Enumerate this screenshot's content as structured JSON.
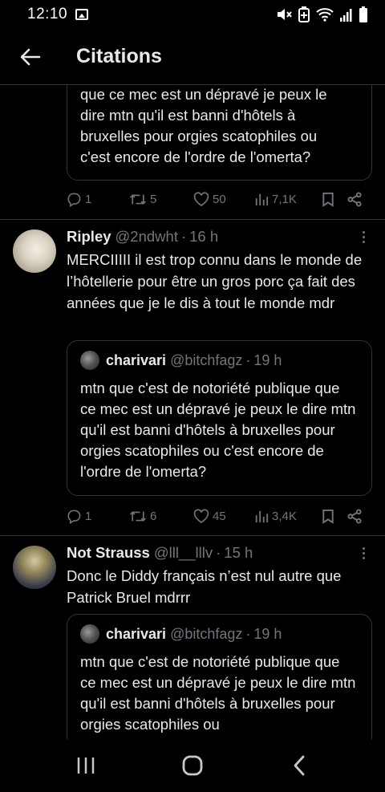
{
  "status_bar": {
    "time": "12:10"
  },
  "header": {
    "title": "Citations"
  },
  "first_tweet": {
    "quote_text_lines": [
      "que ce mec est un dépravé je peux le",
      "dire mtn qu'il est banni d'hôtels à",
      "bruxelles pour orgies scatophiles ou",
      "c'est encore de l'ordre de l'omerta?"
    ],
    "actions": {
      "replies": "1",
      "retweets": "5",
      "likes": "50",
      "views": "7,1K"
    }
  },
  "tweets": [
    {
      "name": "Ripley",
      "handle": "@2ndwht",
      "time": "16 h",
      "text": "MERCIIIII il est trop connu dans le monde de l’hôtellerie pour être un gros porc ça fait des années que je le dis à tout le monde mdr",
      "quote": {
        "name": "charivari",
        "handle": "@bitchfagz",
        "time": "19 h",
        "text": "mtn que c'est de notoriété publique que ce mec est un dépravé je peux le dire mtn qu'il est banni d'hôtels à bruxelles pour orgies scatophiles ou c'est encore de l'ordre de l'omerta?"
      },
      "actions": {
        "replies": "1",
        "retweets": "6",
        "likes": "45",
        "views": "3,4K"
      }
    },
    {
      "name": "Not Strauss",
      "handle": "@lll__lllv",
      "time": "15 h",
      "text": "Donc le Diddy français n’est nul autre que Patrick Bruel mdrrr",
      "quote": {
        "name": "charivari",
        "handle": "@bitchfagz",
        "time": "19 h",
        "text": "mtn que c'est de notoriété publique que ce mec est un dépravé je peux le dire mtn qu'il est banni d'hôtels à bruxelles pour orgies scatophiles ou"
      }
    }
  ],
  "colors": {
    "background": "#000000",
    "text": "#e7e9ea",
    "muted": "#71767b",
    "border": "#2f3336"
  },
  "icons": {
    "status": [
      "gallery-icon",
      "mute-icon",
      "battery-saver-icon",
      "wifi-icon",
      "signal-icon",
      "battery-icon"
    ],
    "actions": [
      "reply-icon",
      "retweet-icon",
      "like-icon",
      "views-icon",
      "bookmark-icon",
      "share-icon"
    ],
    "nav": [
      "recents-icon",
      "home-icon",
      "back-icon"
    ]
  }
}
